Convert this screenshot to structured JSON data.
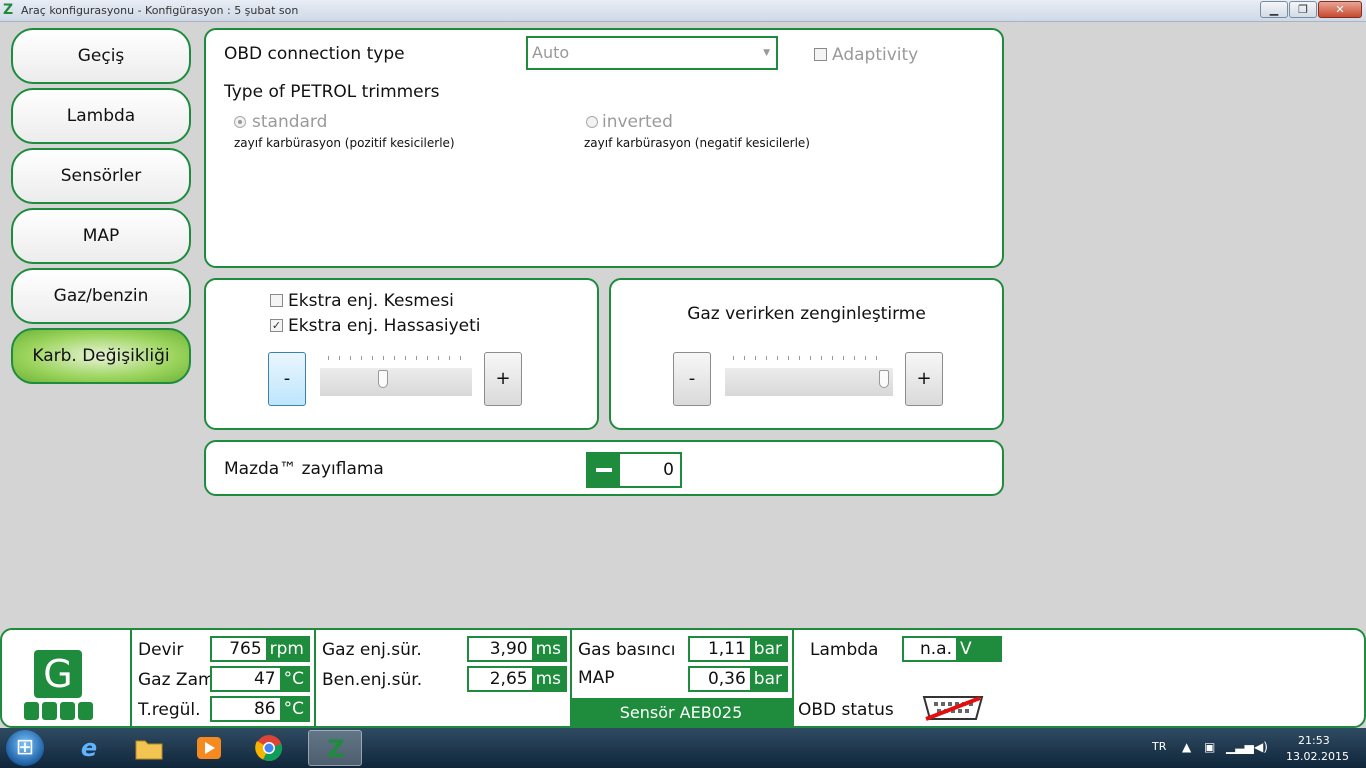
{
  "window": {
    "title": "Araç konfigurasyonu - Konfigürasyon : 5 şubat son",
    "app_icon": "Z",
    "minimize": "▁",
    "maximize": "❐",
    "close": "✕"
  },
  "sidebar": {
    "items": [
      {
        "label": "Geçiş"
      },
      {
        "label": "Lambda"
      },
      {
        "label": "Sensörler"
      },
      {
        "label": "MAP"
      },
      {
        "label": "Gaz/benzin"
      },
      {
        "label": "Karb. Değişikliği",
        "active": true
      }
    ]
  },
  "obd_panel": {
    "connection_label": "OBD connection type",
    "connection_value": "Auto",
    "adaptivity_label": "Adaptivity",
    "trimmers_label": "Type of PETROL trimmers",
    "standard_label": "standard",
    "standard_desc": "zayıf karbürasyon (pozitif kesicilerle)",
    "inverted_label": "inverted",
    "inverted_desc": "zayıf karbürasyon (negatif kesicilerle)"
  },
  "extra_panel": {
    "cut_label": "Ekstra enj. Kesmesi",
    "cut_checked": false,
    "precision_label": "Ekstra enj. Hassasiyeti",
    "precision_checked": true,
    "minus": "-",
    "plus": "+",
    "slider_level": 0.4
  },
  "enrich_panel": {
    "title": "Gaz verirken zenginleştirme",
    "minus": "-",
    "plus": "+",
    "slider_level": 1.0
  },
  "mazda_panel": {
    "label": "Mazda™ zayıflama",
    "value": "0"
  },
  "status": {
    "logo": "G",
    "devir_label": "Devir",
    "devir_value": "765",
    "devir_unit": "rpm",
    "gazzam_label": "Gaz Zam.",
    "gazzam_value": "47",
    "gazzam_unit": "°C",
    "treg_label": "T.regül.",
    "treg_value": "86",
    "treg_unit": "°C",
    "gazenj_label": "Gaz enj.sür.",
    "gazenj_value": "3,90",
    "gazenj_unit": "ms",
    "benenj_label": "Ben.enj.sür.",
    "benenj_value": "2,65",
    "benenj_unit": "ms",
    "gasbas_label": "Gas basıncı",
    "gasbas_value": "1,11",
    "gasbas_unit": "bar",
    "map_label": "MAP",
    "map_value": "0,36",
    "map_unit": "bar",
    "sensor_label": "Sensör AEB025",
    "lambda_label": "Lambda",
    "lambda_value": "n.a.",
    "lambda_unit": "V",
    "obd_label": "OBD status"
  },
  "taskbar": {
    "ie_glyph": "e",
    "zavoli_glyph": "Z",
    "lang": "TR",
    "time": "21:53",
    "date": "13.02.2015"
  },
  "colors": {
    "accent": "#1e8c3c",
    "active_tab": "#8ccc4e"
  }
}
